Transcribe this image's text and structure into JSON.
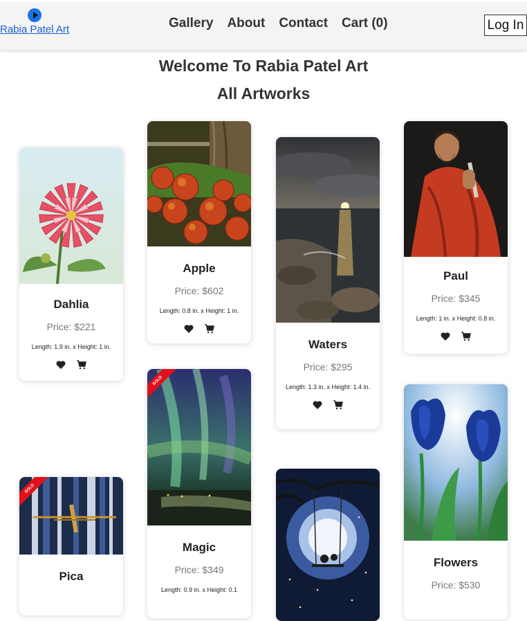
{
  "header": {
    "brand": "Rabia Patel Art",
    "nav": [
      "Gallery",
      "About",
      "Contact",
      "Cart (0)"
    ],
    "login": "Log In"
  },
  "welcome": "Welcome To Rabia Patel Art",
  "heading": "All Artworks",
  "artworks": [
    {
      "title": "Dahlia",
      "price": "Price: $221",
      "dims": "Length: 1.9 in. x Height: 1 in.",
      "sold": false
    },
    {
      "title": "Apple",
      "price": "Price: $602",
      "dims": "Length: 0.8 in. x Height: 1 in.",
      "sold": false
    },
    {
      "title": "Waters",
      "price": "Price: $295",
      "dims": "Length: 1.3 in. x Height: 1.4 in.",
      "sold": false
    },
    {
      "title": "Paul",
      "price": "Price: $345",
      "dims": "Length: 1 in. x Height: 0.8 in.",
      "sold": false
    },
    {
      "title": "Pica",
      "price": "",
      "dims": "",
      "sold": true,
      "sold_label": "SOLD"
    },
    {
      "title": "Magic",
      "price": "Price: $349",
      "dims": "Length: 0.9 in. x Height: 0.1",
      "sold": true,
      "sold_label": "SOLD"
    },
    {
      "title": "",
      "price": "",
      "dims": "",
      "sold": false
    },
    {
      "title": "Flowers",
      "price": "Price: $530",
      "dims": "",
      "sold": false
    }
  ],
  "icons": {
    "like": "heart-icon",
    "cart": "cart-icon"
  }
}
